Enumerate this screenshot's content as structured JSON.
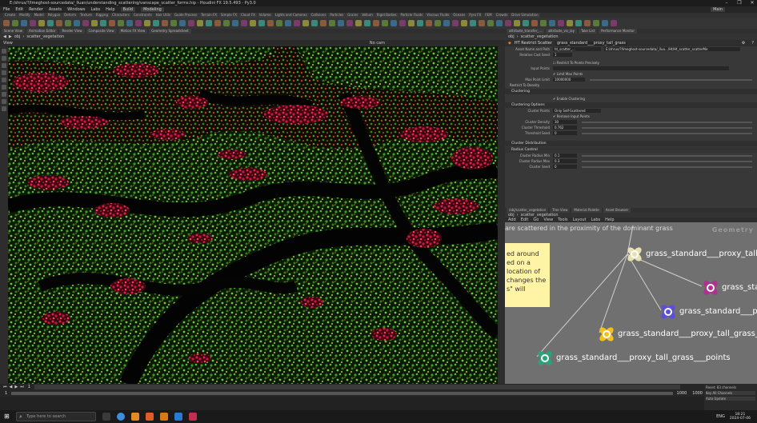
{
  "window": {
    "title": "E:/shrus/?/Imeghost-sourcedata/_lluan/understanding_scattering/vanscape_scatter_forms.hip - Houdini FX 19.5.493 - Py3.0",
    "controls": [
      "–",
      "❐",
      "✕"
    ]
  },
  "menu": {
    "items": [
      "File",
      "Edit",
      "Render",
      "Assets",
      "Windows",
      "Labs",
      "Help"
    ],
    "build_label": "Build",
    "desktop_label": "Modeling",
    "right_label": "Main"
  },
  "shelf_tabs": [
    "Create",
    "Modify",
    "Model",
    "Polygon",
    "Deform",
    "Texture",
    "Rigging",
    "Characters",
    "Constraints",
    "Hair Utils",
    "Guide Process",
    "Terrain FX",
    "Simple FX",
    "Cloud FX",
    "Volume",
    "Lights and Cameras",
    "Collisions",
    "Particles",
    "Grains",
    "Vellum",
    "Rigid Bodies",
    "Particle Fluids",
    "Viscous Fluids",
    "Oceans",
    "Pyro FX",
    "FEM",
    "Crowds",
    "Drive Simulation"
  ],
  "left_pane_tabs": [
    "Scene View",
    "Animation Editor",
    "Render View",
    "Composite View",
    "Motion FX View",
    "Geometry Spreadsheet"
  ],
  "viewport": {
    "path": "obj",
    "node": "scatter_vegetation",
    "view_label": "View",
    "camera_label": "No cam"
  },
  "right_top_tabs": [
    "attribute_transfer_...",
    "attribute_vis_lay",
    "Take List",
    "Performance Monitor"
  ],
  "parm_path": {
    "obj": "obj",
    "node": "scatter_vegetation"
  },
  "parm_header": {
    "type": "HT Restrict Scatter",
    "node_name": "grass_standard___proxy_tall_grass"
  },
  "parms": {
    "asset_name_label": "Asset Name and Path",
    "asset_name": "ht_scatter_...",
    "asset_path": "E:/shrus/?/Imeghost-sourcedata/_llua.../Ht/Ht_scatter_scatterMe",
    "relative_seed_label": "Relative Cast Seed",
    "relative_seed": "1",
    "restrict_label": "Restrict To Points Precisely",
    "input_points_label": "Input Points",
    "limit_points_label": "Limit Max Points",
    "max_points_label": "Max Point Limit",
    "max_points": "10000000",
    "restrict_to_density_label": "Restrict To Density",
    "clustering_section": "Clustering",
    "enable_clustering_label": "Enable Clustering",
    "clustering_options": "Clustering Options",
    "cluster_points_label": "Cluster Points",
    "cluster_points": "Only Self-Scattered",
    "remove_input_label": "Remove Input Points",
    "cluster_density_label": "Cluster Density",
    "cluster_density": "30",
    "cluster_threshold_label": "Cluster Threshold",
    "cluster_threshold": "0.762",
    "threshold_seed_label": "Threshold Seed",
    "threshold_seed": "0",
    "cluster_distribution": "Cluster Distribution",
    "radius_control": "Radius Control",
    "cluster_radius_min_label": "Cluster Radius Min",
    "cluster_radius_min": "0.1",
    "cluster_radius_max_label": "Cluster Radius Max",
    "cluster_radius_max": "0.3",
    "cluster_seed_label": "Cluster Seed",
    "cluster_seed": "0"
  },
  "network_tabs": [
    "/obj/scatter_vegetation",
    "Tree View",
    "Material Palette",
    "Asset Browser"
  ],
  "network_path": {
    "obj": "obj",
    "node": "scatter_vegetation"
  },
  "network_menu": [
    "Add",
    "Edit",
    "Go",
    "View",
    "Tools",
    "Layout",
    "Labs",
    "Help"
  ],
  "network": {
    "caption": "are scattered in the proximity of the dominant grass",
    "context_tag": "Geometry",
    "sticky_lines": [
      "ed around",
      "ed on a",
      "location of",
      "changes the",
      "s\" will"
    ],
    "nodes": [
      {
        "label": "grass_standard___proxy_tall_g",
        "color": "#e8e0b0"
      },
      {
        "label": "grass_stand",
        "color": "#b0308f"
      },
      {
        "label": "grass_standard___pro",
        "color": "#5a4fd6"
      },
      {
        "label": "grass_standard___proxy_tall_grass___v",
        "color": "#f2c21a"
      },
      {
        "label": "grass_standard___proxy_tall_grass___points",
        "color": "#2aa37a"
      }
    ]
  },
  "timeline": {
    "frame": "1",
    "start": "1",
    "end": "1000",
    "end2": "1000"
  },
  "status": {
    "line1": "Reset: 83 channels",
    "line2": "Key All Channels",
    "line3": "Auto Update"
  },
  "taskbar": {
    "search_placeholder": "Type here to search",
    "lang": "ENG",
    "time": "18:21",
    "date": "2024-07-06"
  }
}
